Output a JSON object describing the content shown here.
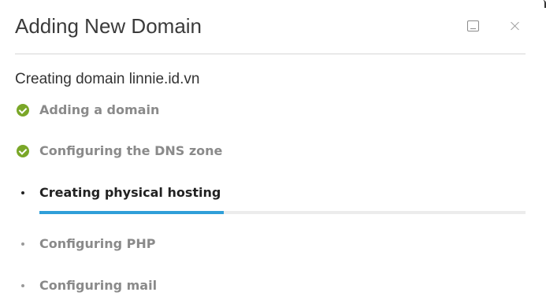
{
  "dialog": {
    "title": "Adding New Domain",
    "subtitle": "Creating domain linnie.id.vn"
  },
  "header_buttons": {
    "minimize_icon": "minimize-icon",
    "close_icon": "close-icon"
  },
  "steps": [
    {
      "label": "Adding a domain",
      "status": "done"
    },
    {
      "label": "Configuring the DNS zone",
      "status": "done"
    },
    {
      "label": "Creating physical hosting",
      "status": "active"
    },
    {
      "label": "Configuring PHP",
      "status": "pending"
    },
    {
      "label": "Configuring mail",
      "status": "pending"
    }
  ],
  "progress": {
    "fraction": 0.38
  },
  "colors": {
    "check": "#7aa728",
    "progress": "#2f9fd9"
  }
}
